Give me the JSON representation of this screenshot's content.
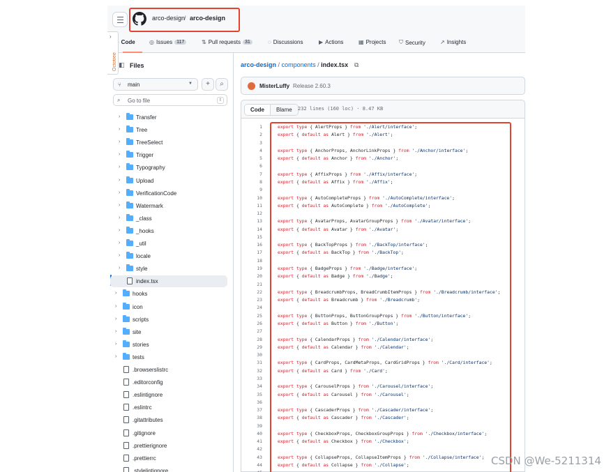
{
  "header": {
    "owner": "arco-design",
    "separator": "/",
    "repo": "arco-design"
  },
  "nav": {
    "items": [
      {
        "label": "Code",
        "icon": "‹›"
      },
      {
        "label": "Issues",
        "icon": "◎",
        "count": "117"
      },
      {
        "label": "Pull requests",
        "icon": "⇅",
        "count": "31"
      },
      {
        "label": "Discussions",
        "icon": "◌"
      },
      {
        "label": "Actions",
        "icon": "▶"
      },
      {
        "label": "Projects",
        "icon": "▦"
      },
      {
        "label": "Security",
        "icon": "⛉"
      },
      {
        "label": "Insights",
        "icon": "↗"
      }
    ]
  },
  "octotree": {
    "label": "Octotree"
  },
  "sidebar": {
    "title": "Files",
    "branch": "main",
    "goto_placeholder": "Go to file",
    "goto_key": "t",
    "tree": [
      {
        "name": "Transfer",
        "type": "dir",
        "depth": 1
      },
      {
        "name": "Tree",
        "type": "dir",
        "depth": 1
      },
      {
        "name": "TreeSelect",
        "type": "dir",
        "depth": 1
      },
      {
        "name": "Trigger",
        "type": "dir",
        "depth": 1
      },
      {
        "name": "Typography",
        "type": "dir",
        "depth": 1
      },
      {
        "name": "Upload",
        "type": "dir",
        "depth": 1
      },
      {
        "name": "VerificationCode",
        "type": "dir",
        "depth": 1
      },
      {
        "name": "Watermark",
        "type": "dir",
        "depth": 1
      },
      {
        "name": "_class",
        "type": "dir",
        "depth": 1
      },
      {
        "name": "_hooks",
        "type": "dir",
        "depth": 1
      },
      {
        "name": "_util",
        "type": "dir",
        "depth": 1
      },
      {
        "name": "locale",
        "type": "dir",
        "depth": 1
      },
      {
        "name": "style",
        "type": "dir",
        "depth": 1
      },
      {
        "name": "index.tsx",
        "type": "file",
        "depth": 1,
        "selected": true
      },
      {
        "name": "hooks",
        "type": "dir",
        "depth": 0
      },
      {
        "name": "icon",
        "type": "dir",
        "depth": 0
      },
      {
        "name": "scripts",
        "type": "dir",
        "depth": 0
      },
      {
        "name": "site",
        "type": "dir",
        "depth": 0
      },
      {
        "name": "stories",
        "type": "dir",
        "depth": 0
      },
      {
        "name": "tests",
        "type": "dir",
        "depth": 0
      },
      {
        "name": ".browserslistrc",
        "type": "file",
        "depth": 0
      },
      {
        "name": ".editorconfig",
        "type": "file",
        "depth": 0
      },
      {
        "name": ".eslintignore",
        "type": "file",
        "depth": 0
      },
      {
        "name": ".eslintrc",
        "type": "file",
        "depth": 0
      },
      {
        "name": ".gitattributes",
        "type": "file",
        "depth": 0
      },
      {
        "name": ".gitignore",
        "type": "file",
        "depth": 0
      },
      {
        "name": ".prettierignore",
        "type": "file",
        "depth": 0
      },
      {
        "name": ".prettierrc",
        "type": "file",
        "depth": 0
      },
      {
        "name": ".stylelintignore",
        "type": "file",
        "depth": 0
      }
    ]
  },
  "main": {
    "path": {
      "root": "arco-design",
      "dir": "components",
      "file": "index.tsx",
      "sep": "/"
    },
    "commit": {
      "author": "MisterLuffy",
      "message": "Release 2.60.3"
    },
    "tabs": {
      "code": "Code",
      "blame": "Blame"
    },
    "file_info": "232 lines (160 loc) · 8.47 KB",
    "lines": [
      {
        "n": "1",
        "t": "export type { AlertProps } from './Alert/interface';"
      },
      {
        "n": "2",
        "t": "export { default as Alert } from './Alert';"
      },
      {
        "n": "3",
        "t": ""
      },
      {
        "n": "4",
        "t": "export type { AnchorProps, AnchorLinkProps } from './Anchor/interface';"
      },
      {
        "n": "5",
        "t": "export { default as Anchor } from './Anchor';"
      },
      {
        "n": "6",
        "t": ""
      },
      {
        "n": "7",
        "t": "export type { AffixProps } from './Affix/interface';"
      },
      {
        "n": "8",
        "t": "export { default as Affix } from './Affix';"
      },
      {
        "n": "9",
        "t": ""
      },
      {
        "n": "10",
        "t": "export type { AutoCompleteProps } from './AutoComplete/interface';"
      },
      {
        "n": "11",
        "t": "export { default as AutoComplete } from './AutoComplete';"
      },
      {
        "n": "12",
        "t": ""
      },
      {
        "n": "13",
        "t": "export type { AvatarProps, AvatarGroupProps } from './Avatar/interface';"
      },
      {
        "n": "14",
        "t": "export { default as Avatar } from './Avatar';"
      },
      {
        "n": "15",
        "t": ""
      },
      {
        "n": "16",
        "t": "export type { BackTopProps } from './BackTop/interface';"
      },
      {
        "n": "17",
        "t": "export { default as BackTop } from './BackTop';"
      },
      {
        "n": "18",
        "t": ""
      },
      {
        "n": "19",
        "t": "export type { BadgeProps } from './Badge/interface';"
      },
      {
        "n": "20",
        "t": "export { default as Badge } from './Badge';"
      },
      {
        "n": "21",
        "t": ""
      },
      {
        "n": "22",
        "t": "export type { BreadcrumbProps, BreadCrumbItemProps } from './Breadcrumb/interface';"
      },
      {
        "n": "23",
        "t": "export { default as Breadcrumb } from './Breadcrumb';"
      },
      {
        "n": "24",
        "t": ""
      },
      {
        "n": "25",
        "t": "export type { ButtonProps, ButtonGroupProps } from './Button/interface';"
      },
      {
        "n": "26",
        "t": "export { default as Button } from './Button';"
      },
      {
        "n": "27",
        "t": ""
      },
      {
        "n": "28",
        "t": "export type { CalendarProps } from './Calendar/interface';"
      },
      {
        "n": "29",
        "t": "export { default as Calendar } from './Calendar';"
      },
      {
        "n": "30",
        "t": ""
      },
      {
        "n": "31",
        "t": "export type { CardProps, CardMetaProps, CardGridProps } from './Card/interface';"
      },
      {
        "n": "32",
        "t": "export { default as Card } from './Card';"
      },
      {
        "n": "33",
        "t": ""
      },
      {
        "n": "34",
        "t": "export type { CarouselProps } from './Carousel/interface';"
      },
      {
        "n": "35",
        "t": "export { default as Carousel } from './Carousel';"
      },
      {
        "n": "36",
        "t": ""
      },
      {
        "n": "37",
        "t": "export type { CascaderProps } from './Cascader/interface';"
      },
      {
        "n": "38",
        "t": "export { default as Cascader } from './Cascader';"
      },
      {
        "n": "39",
        "t": ""
      },
      {
        "n": "40",
        "t": "export type { CheckboxProps, CheckboxGroupProps } from './Checkbox/interface';"
      },
      {
        "n": "41",
        "t": "export { default as Checkbox } from './Checkbox';"
      },
      {
        "n": "42",
        "t": ""
      },
      {
        "n": "43",
        "t": "export type { CollapseProps, CollapseItemProps } from './Collapse/interface';"
      },
      {
        "n": "44",
        "t": "export { default as Collapse } from './Collapse';"
      },
      {
        "n": "45",
        "t": ""
      }
    ]
  },
  "watermark": "CSDN @We-5211314",
  "colors": {
    "accent": "#0969da",
    "highlight_box": "#e5412f",
    "keyword": "#cf222e",
    "string": "#0a3069"
  }
}
